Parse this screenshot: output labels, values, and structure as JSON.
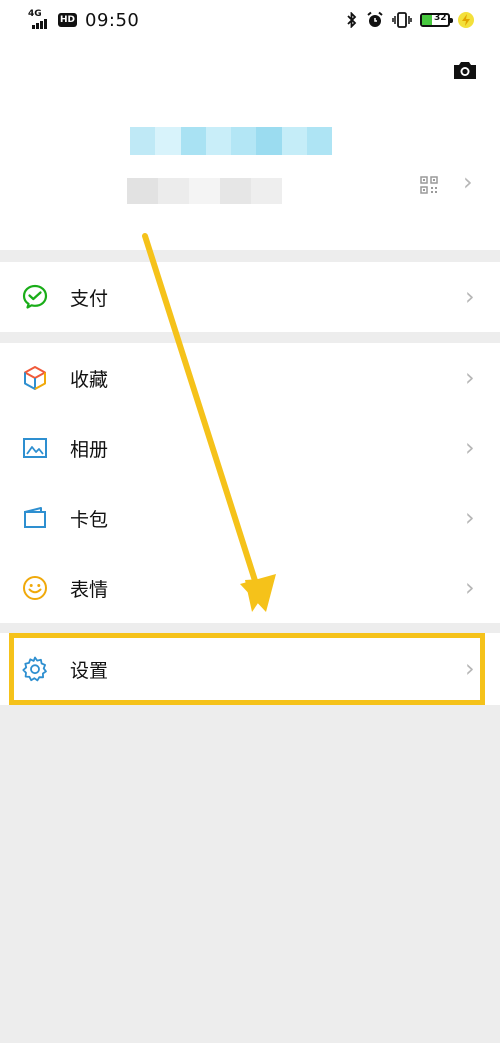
{
  "status_bar": {
    "network": "4G",
    "hd_badge": "HD",
    "time": "09:50",
    "battery_level": "32",
    "icons": [
      "signal-icon",
      "bluetooth-icon",
      "alarm-icon",
      "vibrate-icon",
      "battery-icon",
      "charging-icon"
    ]
  },
  "profile": {
    "camera_icon": "camera-icon",
    "qr_icon": "qr-code-icon",
    "chevron": "›"
  },
  "menu": {
    "pay": {
      "label": "支付",
      "icon": "wechat-pay-icon",
      "color": "#1aad19"
    },
    "favorites": {
      "label": "收藏",
      "icon": "cube-icon"
    },
    "album": {
      "label": "相册",
      "icon": "picture-icon",
      "color": "#2e8fd0"
    },
    "cards": {
      "label": "卡包",
      "icon": "wallet-icon",
      "color": "#2e8fd0"
    },
    "stickers": {
      "label": "表情",
      "icon": "smile-icon",
      "color": "#f0a90a"
    },
    "settings": {
      "label": "设置",
      "icon": "gear-icon",
      "color": "#2e8fd0"
    },
    "chevron": "›"
  },
  "annotation": {
    "highlight_color": "#f5c21a",
    "arrow_color": "#f5c21a"
  }
}
